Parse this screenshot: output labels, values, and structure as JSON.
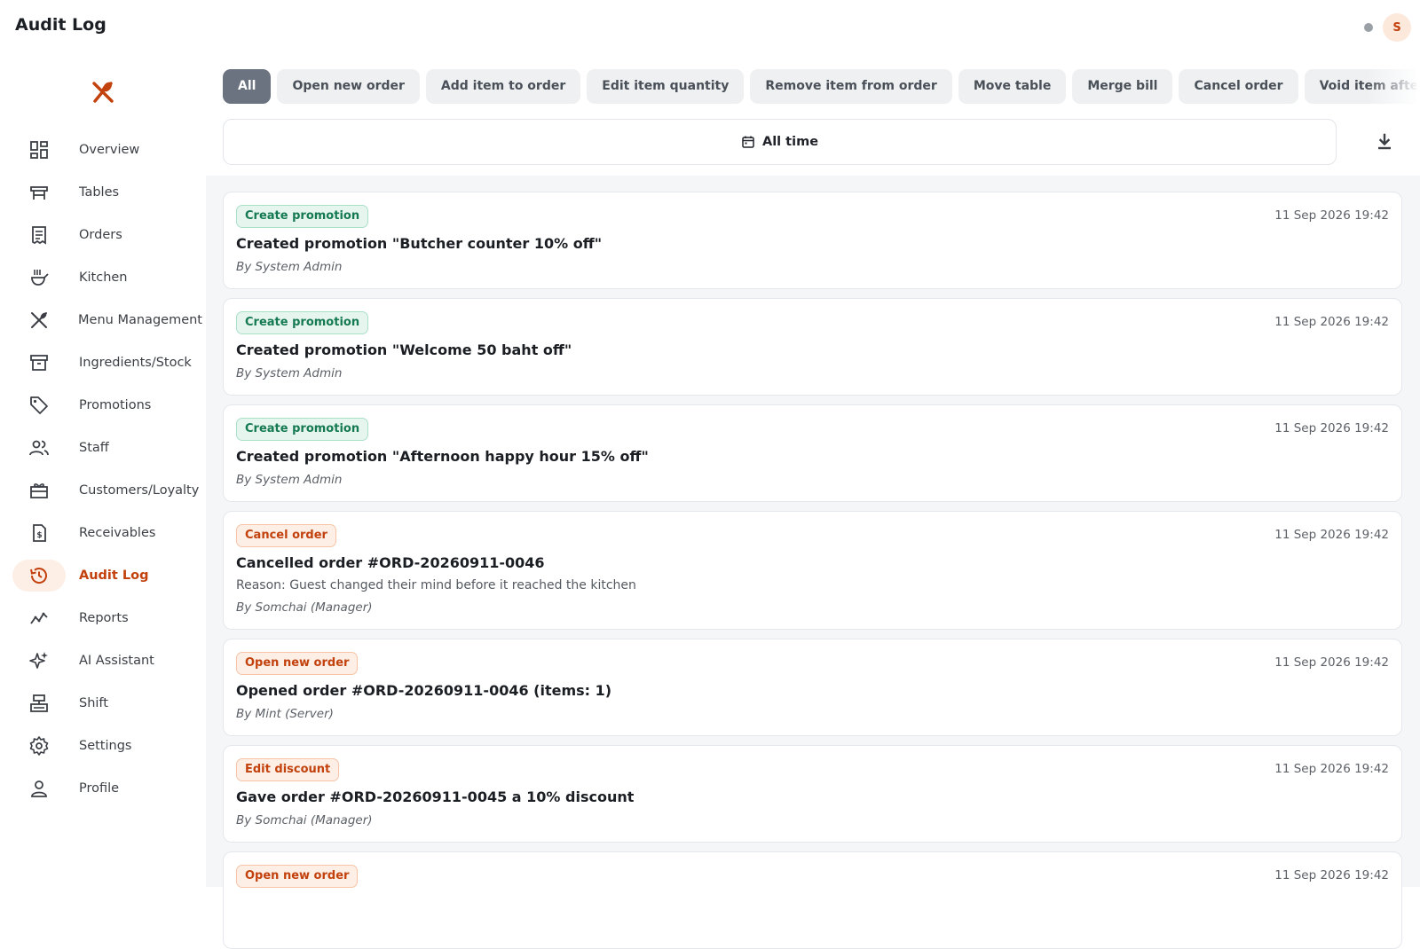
{
  "header": {
    "title": "Audit Log",
    "avatar_initial": "S"
  },
  "sidebar": {
    "items": [
      {
        "label": "Overview",
        "icon": "dashboard-icon"
      },
      {
        "label": "Tables",
        "icon": "table-icon"
      },
      {
        "label": "Orders",
        "icon": "receipt-icon"
      },
      {
        "label": "Kitchen",
        "icon": "kitchen-icon"
      },
      {
        "label": "Menu Management",
        "icon": "utensils-icon"
      },
      {
        "label": "Ingredients/Stock",
        "icon": "archive-box-icon"
      },
      {
        "label": "Promotions",
        "icon": "tag-icon"
      },
      {
        "label": "Staff",
        "icon": "people-icon"
      },
      {
        "label": "Customers/Loyalty",
        "icon": "gift-card-icon"
      },
      {
        "label": "Receivables",
        "icon": "invoice-icon"
      },
      {
        "label": "Audit Log",
        "icon": "history-icon",
        "active": true
      },
      {
        "label": "Reports",
        "icon": "trend-chart-icon"
      },
      {
        "label": "AI Assistant",
        "icon": "sparkle-icon"
      },
      {
        "label": "Shift",
        "icon": "cash-register-icon"
      },
      {
        "label": "Settings",
        "icon": "gear-icon"
      },
      {
        "label": "Profile",
        "icon": "person-icon"
      }
    ]
  },
  "filters": {
    "chips": [
      "All",
      "Open new order",
      "Add item to order",
      "Edit item quantity",
      "Remove item from order",
      "Move table",
      "Merge bill",
      "Cancel order",
      "Void item after cooking"
    ],
    "active_chip": "All",
    "date_range": "All time"
  },
  "logs": [
    {
      "action": "Create promotion",
      "tone": "green",
      "time": "11 Sep 2026 19:42",
      "title": "Created promotion \"Butcher counter 10% off\"",
      "reason": "",
      "by": "By System Admin"
    },
    {
      "action": "Create promotion",
      "tone": "green",
      "time": "11 Sep 2026 19:42",
      "title": "Created promotion \"Welcome 50 baht off\"",
      "reason": "",
      "by": "By System Admin"
    },
    {
      "action": "Create promotion",
      "tone": "green",
      "time": "11 Sep 2026 19:42",
      "title": "Created promotion \"Afternoon happy hour 15% off\"",
      "reason": "",
      "by": "By System Admin"
    },
    {
      "action": "Cancel order",
      "tone": "orange",
      "time": "11 Sep 2026 19:42",
      "title": "Cancelled order #ORD-20260911-0046",
      "reason": "Reason: Guest changed their mind before it reached the kitchen",
      "by": "By Somchai (Manager)"
    },
    {
      "action": "Open new order",
      "tone": "orange",
      "time": "11 Sep 2026 19:42",
      "title": "Opened order #ORD-20260911-0046 (items: 1)",
      "reason": "",
      "by": "By Mint (Server)"
    },
    {
      "action": "Edit discount",
      "tone": "orange",
      "time": "11 Sep 2026 19:42",
      "title": "Gave order #ORD-20260911-0045 a 10% discount",
      "reason": "",
      "by": "By Somchai (Manager)"
    },
    {
      "action": "Open new order",
      "tone": "orange",
      "time": "11 Sep 2026 19:42",
      "title": "",
      "reason": "",
      "by": ""
    }
  ],
  "colors": {
    "accent": "#c2410c",
    "active_chip": "#6b7280",
    "badge_green": "#157a52",
    "badge_orange": "#c2410c"
  }
}
